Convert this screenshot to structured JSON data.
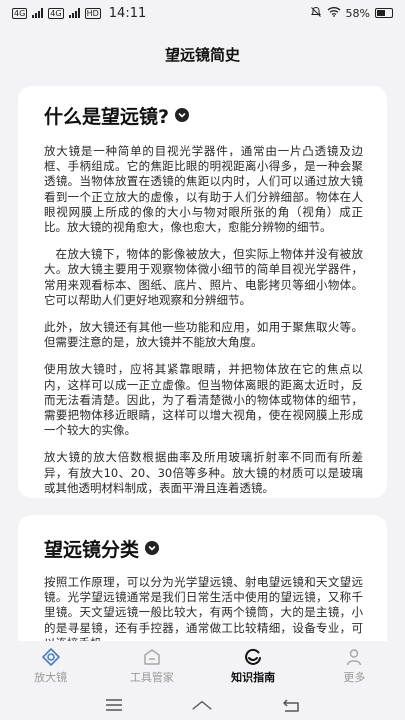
{
  "status": {
    "network": "4G",
    "network2": "4G",
    "hd_tag": "HD",
    "time": "14:11",
    "battery": "58%"
  },
  "page": {
    "title": "望远镜简史"
  },
  "sections": [
    {
      "title": "什么是望远镜?",
      "paragraphs": [
        "放大镜是一种简单的目视光学器件，通常由一片凸透镜及边框、手柄组成。它的焦距比眼的明视距离小得多，是一种会聚透镜。当物体放置在透镜的焦距以内时，人们可以通过放大镜看到一个正立放大的虚像，以有助于人们分辨细部。物体在人眼视网膜上所成的像的大小与物对眼所张的角（视角）成正比。放大镜的视角愈大，像也愈大，愈能分辨物的细节。",
        "在放大镜下，物体的影像被放大，但实际上物体并没有被放大。放大镜主要用于观察物体微小细节的简单目视光学器件，常用来观看标本、图纸、底片、照片、电影拷贝等细小物体。它可以帮助人们更好地观察和分辨细节。",
        "此外，放大镜还有其他一些功能和应用，如用于聚焦取火等。但需要注意的是，放大镜并不能放大角度。",
        "使用放大镜时，应将其紧靠眼睛，并把物体放在它的焦点以内，这样可以成一正立虚像。但当物体离眼的距离太近时，反而无法看清楚。因此，为了看清楚微小的物体或物体的细节，需要把物体移近眼睛，这样可以增大视角，使在视网膜上形成一个较大的实像。",
        "放大镜的放大倍数根据曲率及所用玻璃折射率不同而有所差异，有放大10、20、30倍等多种。放大镜的材质可以是玻璃或其他透明材料制成，表面平滑且连着透镜。"
      ]
    },
    {
      "title": "望远镜分类",
      "paragraphs": [
        "按照工作原理，可以分为光学望远镜、射电望远镜和天文望远镜。光学望远镜通常是我们日常生活中使用的望远镜，又称千里镜。天文望远镜一般比较大，有两个镜筒，大的是主镜，小的是寻星镜，还有手控器，通常做工比较精细，设备专业，可以连接手机、"
      ]
    }
  ],
  "bottom_nav": [
    {
      "label": "放大镜",
      "icon": "magnifier-icon",
      "active": false
    },
    {
      "label": "工具管家",
      "icon": "toolbox-icon",
      "active": false
    },
    {
      "label": "知识指南",
      "icon": "guide-icon",
      "active": true
    },
    {
      "label": "更多",
      "icon": "person-icon",
      "active": false
    }
  ]
}
